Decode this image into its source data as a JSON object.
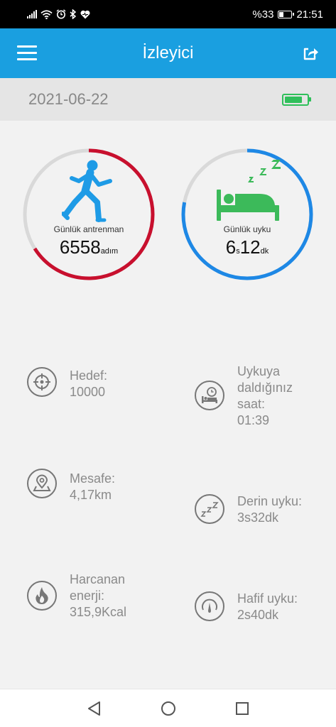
{
  "status_bar": {
    "battery_text": "%33",
    "time": "21:51",
    "battery_level": 0.33,
    "icons": [
      "signal-icon",
      "wifi-icon",
      "alarm-icon",
      "bluetooth-icon",
      "heart-icon"
    ]
  },
  "app_bar": {
    "title": "İzleyici",
    "menu_icon": "hamburger-menu-icon",
    "share_icon": "share-icon"
  },
  "date_bar": {
    "date": "2021-06-22",
    "device_battery_level": 0.7,
    "device_battery_color": "#2fbf5a"
  },
  "activity_ring": {
    "label": "Günlük antrenman",
    "value": "6558",
    "unit": "adım",
    "progress": 0.66,
    "color": "#c8102e",
    "icon": "running-person-icon"
  },
  "sleep_ring": {
    "label": "Günlük uyku",
    "hours": "6",
    "hours_unit": "s",
    "minutes": "12",
    "minutes_unit": "dk",
    "progress": 0.78,
    "color": "#1e88e5",
    "icon": "sleeping-bed-icon"
  },
  "stats": {
    "goal": {
      "label": "Hedef:",
      "value": "10000",
      "icon": "target-icon"
    },
    "sleep_time": {
      "label1": "Uykuya",
      "label2": "daldığınız",
      "label3": "saat:",
      "value": "01:39",
      "icon": "bed-clock-icon"
    },
    "distance": {
      "label": "Mesafe:",
      "value": "4,17km",
      "icon": "location-map-icon"
    },
    "deep_sleep": {
      "label": "Derin uyku:",
      "value": "3s32dk",
      "icon": "zzz-icon"
    },
    "energy": {
      "label1": "Harcanan",
      "label2": "enerji:",
      "value": "315,9Kcal",
      "icon": "flame-icon"
    },
    "light_sleep": {
      "label": "Hafif uyku:",
      "value": "2s40dk",
      "icon": "gauge-icon"
    }
  },
  "nav_bar": {
    "icons": [
      "back-icon",
      "home-icon",
      "recents-icon"
    ]
  },
  "colors": {
    "app_bar": "#1a9fe0",
    "ring_track": "#d9d9d9"
  }
}
